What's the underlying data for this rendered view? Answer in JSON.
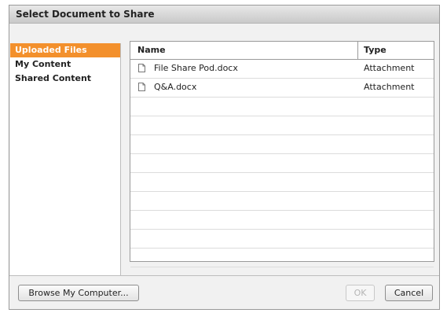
{
  "dialog": {
    "title": "Select Document to Share"
  },
  "sidebar": {
    "items": [
      {
        "label": "Uploaded Files",
        "selected": true
      },
      {
        "label": "My Content",
        "selected": false
      },
      {
        "label": "Shared Content",
        "selected": false
      }
    ]
  },
  "table": {
    "columns": {
      "name": "Name",
      "type": "Type"
    },
    "rows": [
      {
        "icon": "document-icon",
        "name": "File Share Pod.docx",
        "type": "Attachment"
      },
      {
        "icon": "document-icon",
        "name": "Q&A.docx",
        "type": "Attachment"
      }
    ]
  },
  "footer": {
    "browse_label": "Browse My Computer...",
    "ok_label": "OK",
    "cancel_label": "Cancel"
  },
  "colors": {
    "accent": "#f3902c"
  }
}
